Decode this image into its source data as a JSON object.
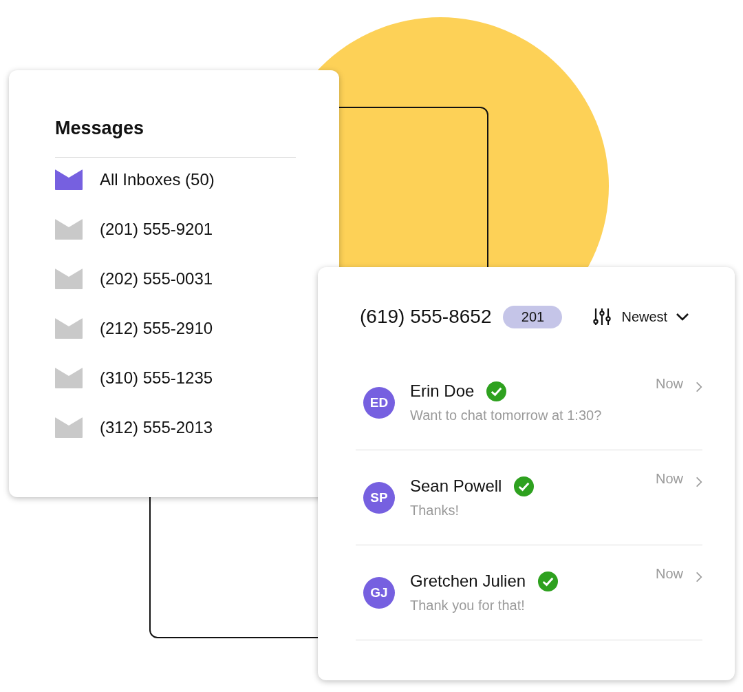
{
  "inboxes_panel": {
    "title": "Messages",
    "items": [
      {
        "label": "All Inboxes (50)",
        "selected": true
      },
      {
        "label": "(201) 555-9201",
        "selected": false
      },
      {
        "label": "(202) 555-0031",
        "selected": false
      },
      {
        "label": "(212) 555-2910",
        "selected": false
      },
      {
        "label": "(310) 555-1235",
        "selected": false
      },
      {
        "label": "(312) 555-2013",
        "selected": false
      }
    ]
  },
  "conversation_panel": {
    "phone": "(619) 555-8652",
    "badge": "201",
    "sort": "Newest",
    "conversations": [
      {
        "initials": "ED",
        "name": "Erin Doe",
        "verified": true,
        "preview": "Want to chat tomorrow at 1:30?",
        "time": "Now"
      },
      {
        "initials": "SP",
        "name": "Sean Powell",
        "verified": true,
        "preview": "Thanks!",
        "time": "Now"
      },
      {
        "initials": "GJ",
        "name": "Gretchen Julien",
        "verified": true,
        "preview": "Thank you for that!",
        "time": "Now"
      }
    ]
  }
}
